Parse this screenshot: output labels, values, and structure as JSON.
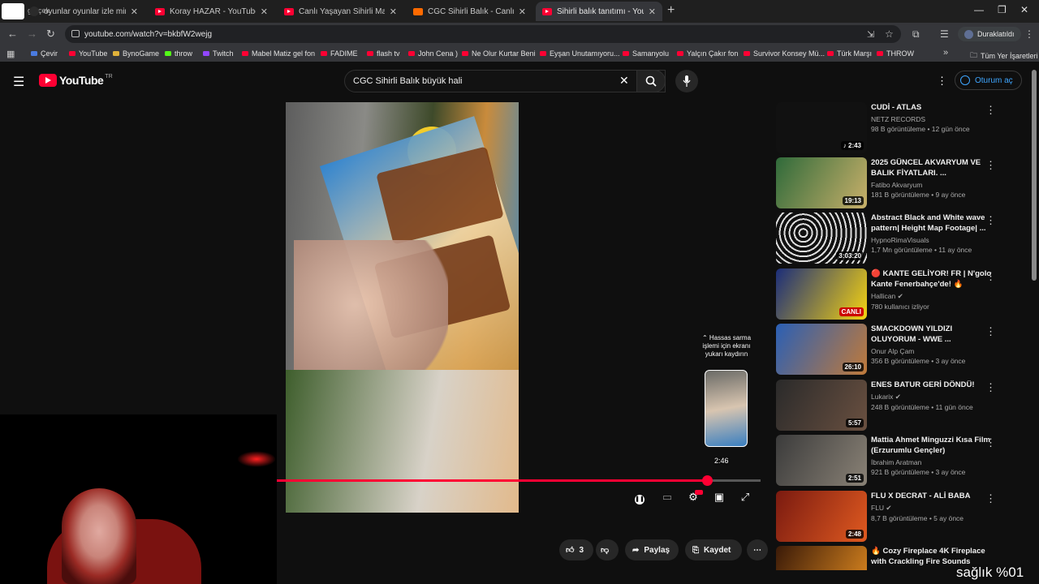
{
  "tabs": [
    {
      "label": "oyunlar oyunlar izle minecraft - Google'da Ara",
      "icon": "google-icon"
    },
    {
      "label": "Koray HAZAR - YouTube",
      "icon": "youtube-icon"
    },
    {
      "label": "Canlı Yaşayan Sihirli Maymun ı",
      "icon": "youtube-icon"
    },
    {
      "label": "CGC Sihirli Balık - Canlı Balık Y",
      "icon": "hb-icon"
    },
    {
      "label": "Sihirli balık tanıtımı - YouTube",
      "icon": "youtube-icon",
      "active": true
    }
  ],
  "tab_overlay_text": "gerçek",
  "browser": {
    "url": "youtube.com/watch?v=bkbfW2wejg",
    "profile_label": "Duraklatıldı"
  },
  "bookmarks": [
    "Çevir",
    "YouTube",
    "BynoGame",
    "throw",
    "Twitch",
    "Mabel Matiz gel fon",
    "FADIME",
    "flash tv",
    "John Cena )",
    "Ne Olur Kurtar Beni",
    "Eyşan Unutamıyoru...",
    "Samanyolu",
    "Yalçın Çakır fon",
    "Survivor Konsey Mü...",
    "Türk Marşı",
    "THROW"
  ],
  "bookmarks_all_label": "Tüm Yer İşaretleri",
  "youtube": {
    "logo_text": "YouTube",
    "country_code": "TR",
    "search_query": "CGC Sihirli Balık büyük hali",
    "signin_label": "Oturum aç"
  },
  "player": {
    "progress_fraction": 0.89,
    "preview_time": "2:46",
    "hint_text": "⌃ Hassas sarma işlemi için ekranı yukarı kaydırın"
  },
  "actions": {
    "like_count": "3",
    "share_label": "Paylaş",
    "save_label": "Kaydet"
  },
  "recommendations": [
    {
      "title": "CUDİ - ATLAS",
      "channel": "NETZ RECORDS",
      "stats": "98 B görüntüleme • 12 gün önce",
      "duration": "♪ 2:43",
      "thumb_color": "#111"
    },
    {
      "title": "2025 GÜNCEL AKVARYUM VE BALIK FİYATLARI. ...",
      "channel": "Fatibo Akvaryum",
      "stats": "181 B görüntüleme • 9 ay önce",
      "duration": "19:13",
      "thumb_color": "#2f6a3a"
    },
    {
      "title": "Abstract Black and White wave pattern| Height Map Footage| ...",
      "channel": "HypnoRimaVisuals",
      "stats": "1,7 Mn görüntüleme • 11 ay önce",
      "duration": "3:03:20",
      "thumb_color": "#222"
    },
    {
      "title": "🔴 KANTE GELİYOR! FR | N'golo Kante Fenerbahçe'de! 🔥",
      "channel": "Hallican ✔",
      "stats": "780 kullanıcı izliyor",
      "duration": "CANLI",
      "thumb_color": "#1b2d7a"
    },
    {
      "title": "SMACKDOWN YILDIZI OLUYORUM - WWE ...",
      "channel": "Onur Alp Çam",
      "stats": "356 B görüntüleme • 3 ay önce",
      "duration": "26:10",
      "thumb_color": "#2a5fb5"
    },
    {
      "title": "ENES BATUR GERİ DÖNDÜ!",
      "channel": "Lukarix ✔",
      "stats": "248 B görüntüleme • 11 gün önce",
      "duration": "5:57",
      "thumb_color": "#2a2a2a"
    },
    {
      "title": "Mattia Ahmet Minguzzi Kısa Film (Erzurumlu Gençler)",
      "channel": "İbrahim Aratman",
      "stats": "921 B görüntüleme • 3 ay önce",
      "duration": "2:51",
      "thumb_color": "#3b3b3b"
    },
    {
      "title": "FLU X DECRAT - ALİ BABA",
      "channel": "FLU ✔",
      "stats": "8,7 B görüntüleme • 5 ay önce",
      "duration": "2:48",
      "thumb_color": "#7a1a10"
    },
    {
      "title": "🔥 Cozy Fireplace 4K Fireplace with Crackling Fire Sounds",
      "channel": "",
      "stats": "",
      "duration": "",
      "thumb_color": "#3a1a08"
    }
  ],
  "overlay_text": "sağlık %01",
  "colors": {
    "accent": "#ff0033",
    "link": "#3ea6ff",
    "background": "#0f0f0f"
  }
}
